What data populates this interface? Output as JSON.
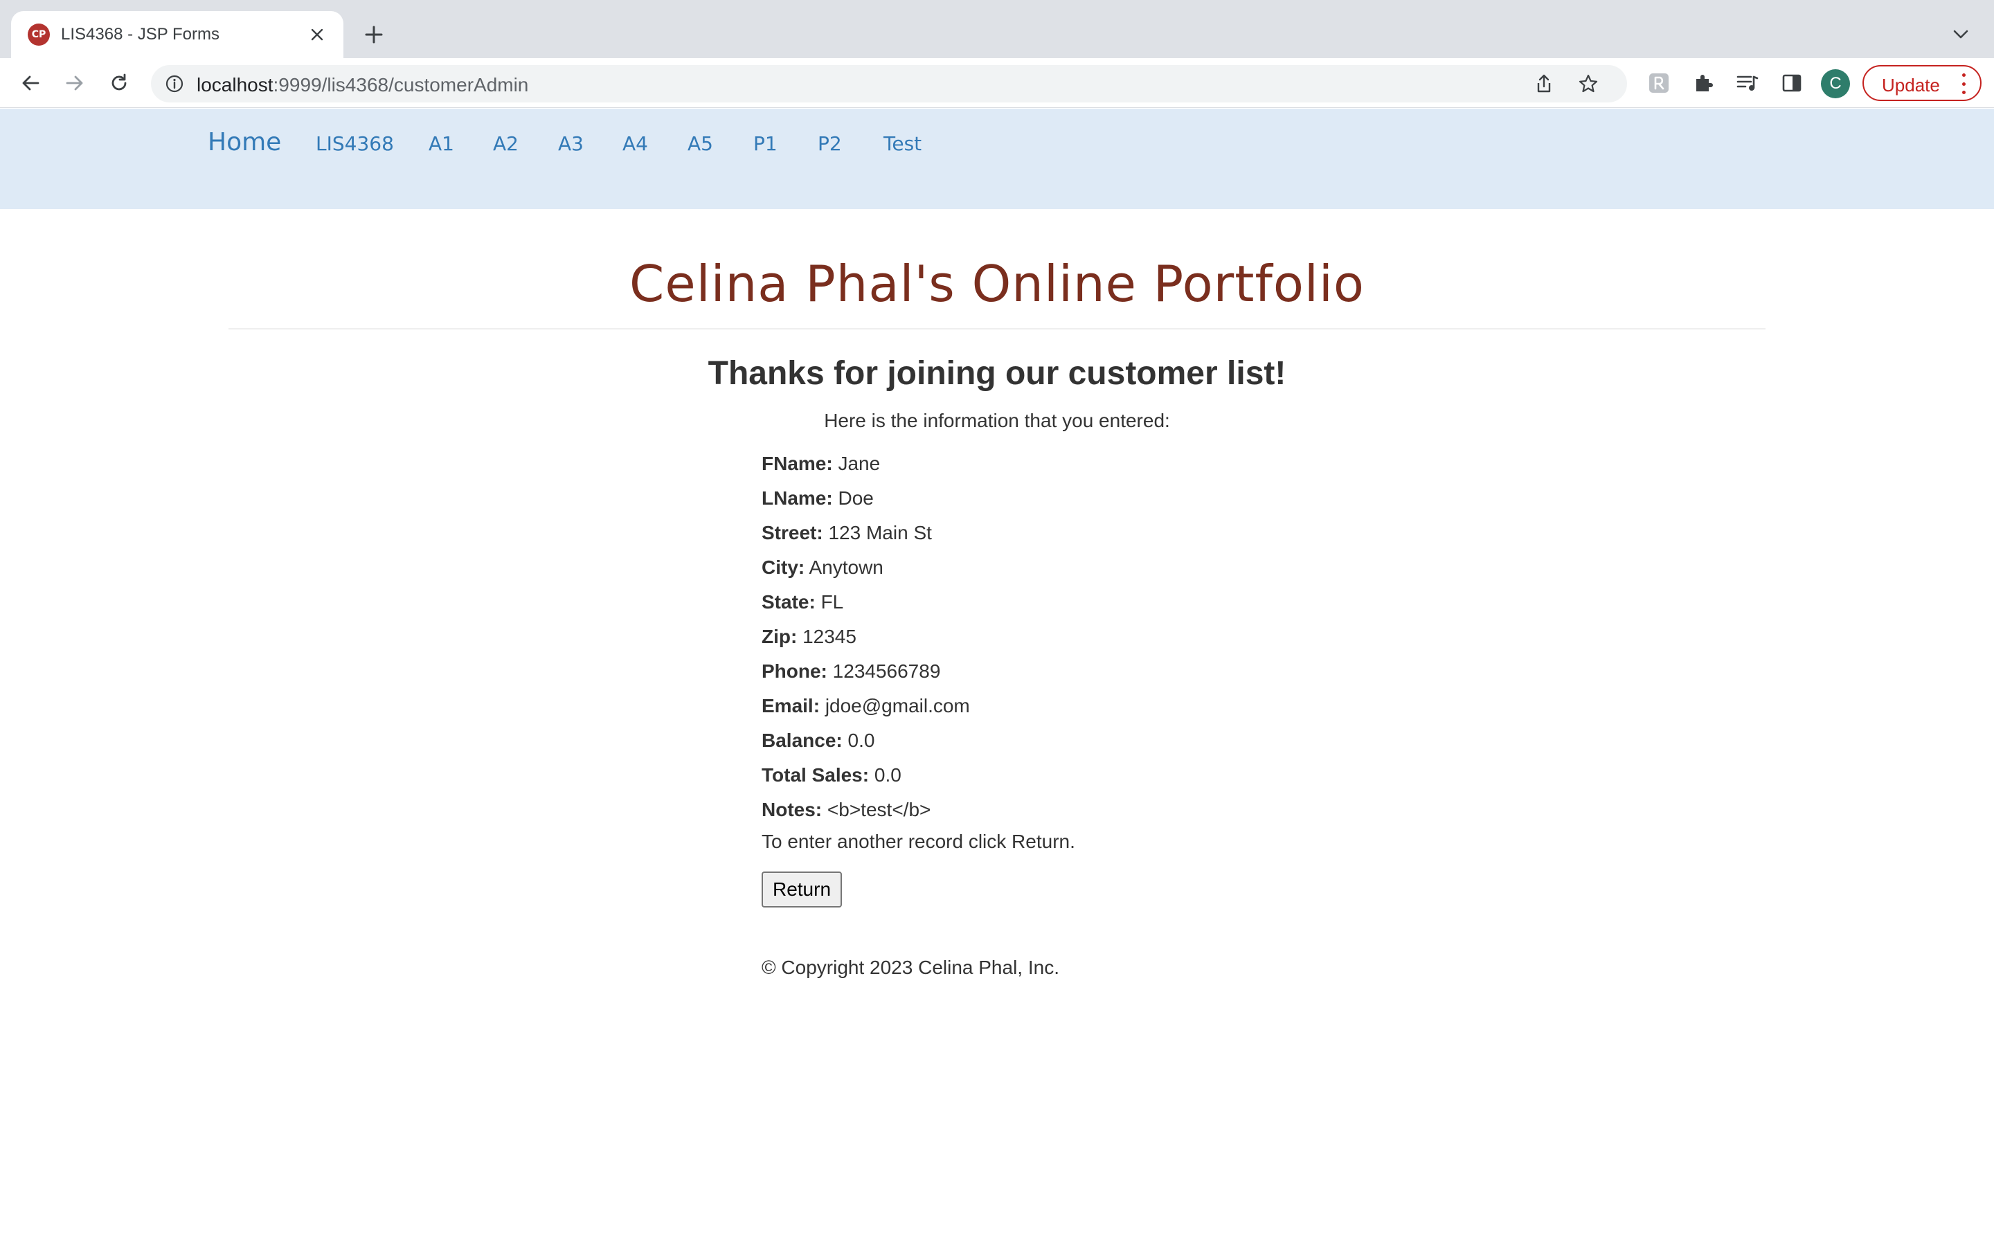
{
  "browser": {
    "tab": {
      "favicon_text": "CP",
      "title": "LIS4368 - JSP Forms"
    },
    "url": {
      "host": "localhost",
      "path": ":9999/lis4368/customerAdmin"
    },
    "profile_initial": "C",
    "update_label": "Update",
    "accent_color": "#c5221f"
  },
  "navbar": {
    "brand": "Home",
    "links": [
      "LIS4368",
      "A1",
      "A2",
      "A3",
      "A4",
      "A5",
      "P1",
      "P2",
      "Test"
    ],
    "background": "#deeaf6",
    "link_color": "#337ab7"
  },
  "page": {
    "title": "Celina Phal's Online Portfolio",
    "heading": "Thanks for joining our customer list!",
    "intro": "Here is the information that you entered:",
    "fields": [
      {
        "label": "FName:",
        "value": "Jane"
      },
      {
        "label": "LName:",
        "value": "Doe"
      },
      {
        "label": "Street:",
        "value": "123 Main St"
      },
      {
        "label": "City:",
        "value": "Anytown"
      },
      {
        "label": "State:",
        "value": "FL"
      },
      {
        "label": "Zip:",
        "value": "12345"
      },
      {
        "label": "Phone:",
        "value": "1234566789"
      },
      {
        "label": "Email:",
        "value": "jdoe@gmail.com"
      },
      {
        "label": "Balance:",
        "value": "0.0"
      },
      {
        "label": "Total Sales:",
        "value": "0.0"
      },
      {
        "label": "Notes:",
        "value": "<b>test</b>"
      }
    ],
    "again_text": "To enter another record click Return.",
    "return_label": "Return",
    "copyright": "© Copyright 2023 Celina Phal, Inc.",
    "title_color": "#7a2e1e"
  }
}
